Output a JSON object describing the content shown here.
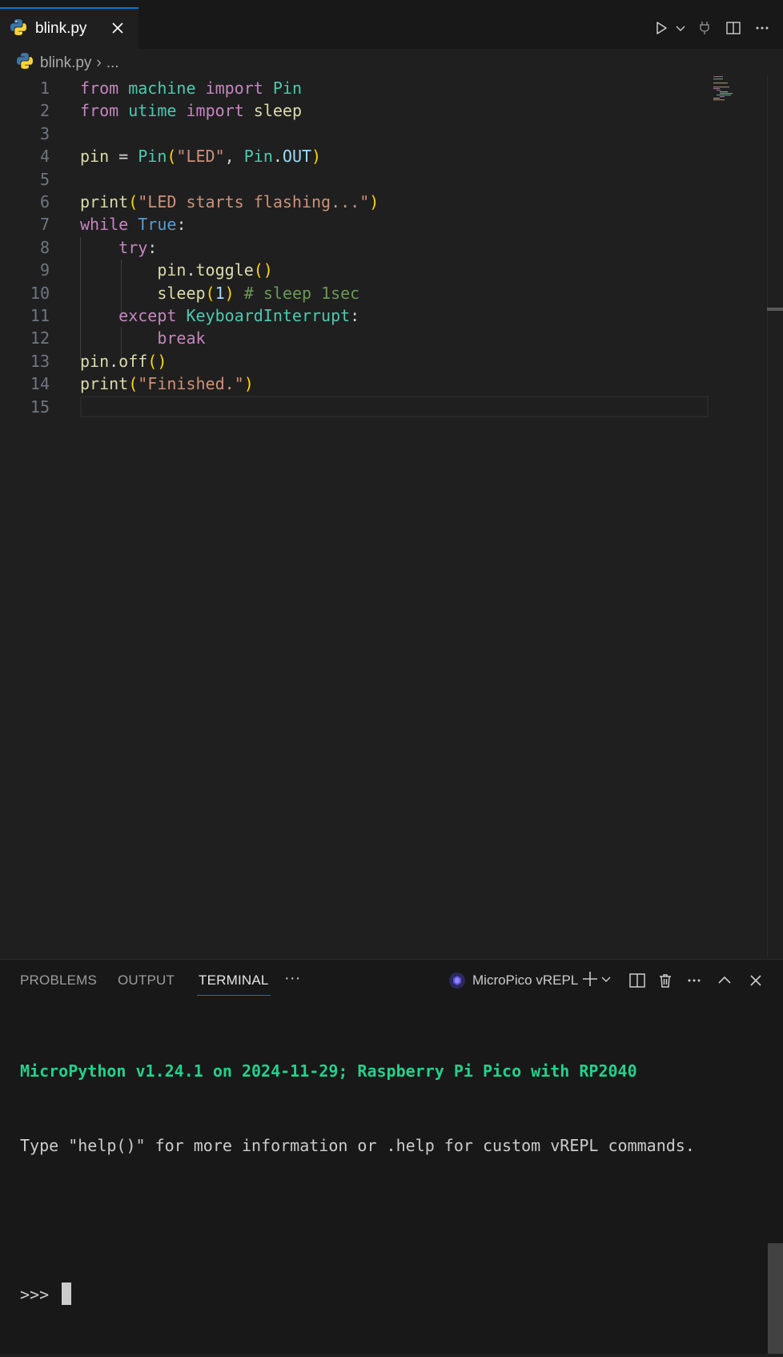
{
  "tab": {
    "filename": "blink.py",
    "close_glyph": "✕"
  },
  "editor_actions": [
    "run-icon",
    "chevron-down-icon",
    "plug-icon",
    "split-editor-icon",
    "more-icon"
  ],
  "breadcrumb": {
    "file": "blink.py",
    "separator": "›",
    "rest": "..."
  },
  "code_lines": [
    {
      "n": "1",
      "tokens": [
        {
          "t": "from",
          "c": "k"
        },
        {
          "t": " ",
          "c": "o"
        },
        {
          "t": "machine",
          "c": "t"
        },
        {
          "t": " ",
          "c": "o"
        },
        {
          "t": "import",
          "c": "k"
        },
        {
          "t": " ",
          "c": "o"
        },
        {
          "t": "Pin",
          "c": "t"
        }
      ]
    },
    {
      "n": "2",
      "tokens": [
        {
          "t": "from",
          "c": "k"
        },
        {
          "t": " ",
          "c": "o"
        },
        {
          "t": "utime",
          "c": "t"
        },
        {
          "t": " ",
          "c": "o"
        },
        {
          "t": "import",
          "c": "k"
        },
        {
          "t": " ",
          "c": "o"
        },
        {
          "t": "sleep",
          "c": "v"
        }
      ]
    },
    {
      "n": "3",
      "tokens": []
    },
    {
      "n": "4",
      "tokens": [
        {
          "t": "pin",
          "c": "v"
        },
        {
          "t": " = ",
          "c": "o"
        },
        {
          "t": "Pin",
          "c": "t"
        },
        {
          "t": "(",
          "c": "p"
        },
        {
          "t": "\"LED\"",
          "c": "s"
        },
        {
          "t": ", ",
          "c": "o"
        },
        {
          "t": "Pin",
          "c": "t"
        },
        {
          "t": ".",
          "c": "o"
        },
        {
          "t": "OUT",
          "c": "a"
        },
        {
          "t": ")",
          "c": "p"
        }
      ]
    },
    {
      "n": "5",
      "tokens": []
    },
    {
      "n": "6",
      "tokens": [
        {
          "t": "print",
          "c": "v"
        },
        {
          "t": "(",
          "c": "p"
        },
        {
          "t": "\"LED starts flashing...\"",
          "c": "s"
        },
        {
          "t": ")",
          "c": "p"
        }
      ]
    },
    {
      "n": "7",
      "tokens": [
        {
          "t": "while",
          "c": "k"
        },
        {
          "t": " ",
          "c": "o"
        },
        {
          "t": "True",
          "c": "b"
        },
        {
          "t": ":",
          "c": "o"
        }
      ]
    },
    {
      "n": "8",
      "tokens": [
        {
          "t": "    ",
          "c": "o"
        },
        {
          "t": "try",
          "c": "k"
        },
        {
          "t": ":",
          "c": "o"
        }
      ]
    },
    {
      "n": "9",
      "tokens": [
        {
          "t": "        ",
          "c": "o"
        },
        {
          "t": "pin",
          "c": "v"
        },
        {
          "t": ".",
          "c": "o"
        },
        {
          "t": "toggle",
          "c": "v"
        },
        {
          "t": "()",
          "c": "p"
        }
      ]
    },
    {
      "n": "10",
      "tokens": [
        {
          "t": "        ",
          "c": "o"
        },
        {
          "t": "sleep",
          "c": "v"
        },
        {
          "t": "(",
          "c": "p"
        },
        {
          "t": "1",
          "c": "a"
        },
        {
          "t": ")",
          "c": "p"
        },
        {
          "t": " ",
          "c": "o"
        },
        {
          "t": "# sleep 1sec",
          "c": "c"
        }
      ]
    },
    {
      "n": "11",
      "tokens": [
        {
          "t": "    ",
          "c": "o"
        },
        {
          "t": "except",
          "c": "k"
        },
        {
          "t": " ",
          "c": "o"
        },
        {
          "t": "KeyboardInterrupt",
          "c": "t"
        },
        {
          "t": ":",
          "c": "o"
        }
      ]
    },
    {
      "n": "12",
      "tokens": [
        {
          "t": "        ",
          "c": "o"
        },
        {
          "t": "break",
          "c": "k"
        }
      ]
    },
    {
      "n": "13",
      "tokens": [
        {
          "t": "pin",
          "c": "v"
        },
        {
          "t": ".",
          "c": "o"
        },
        {
          "t": "off",
          "c": "v"
        },
        {
          "t": "()",
          "c": "p"
        }
      ]
    },
    {
      "n": "14",
      "tokens": [
        {
          "t": "print",
          "c": "v"
        },
        {
          "t": "(",
          "c": "p"
        },
        {
          "t": "\"Finished.\"",
          "c": "s"
        },
        {
          "t": ")",
          "c": "p"
        }
      ]
    },
    {
      "n": "15",
      "tokens": []
    }
  ],
  "panel": {
    "tabs": [
      "PROBLEMS",
      "OUTPUT",
      "TERMINAL"
    ],
    "active_tab": "TERMINAL",
    "more": "···",
    "terminal_name": "MicroPico vREPL"
  },
  "terminal": {
    "banner": "MicroPython v1.24.1 on 2024-11-29; Raspberry Pi Pico with RP2040",
    "help_line": "Type \"help()\" for more information or .help for custom vREPL commands.",
    "prompt": ">>> "
  },
  "colors": {
    "accent": "#0078d4",
    "editor_bg": "#1f1f1f",
    "chrome_bg": "#181818",
    "keyword": "#c586c0",
    "type": "#4ec9b0",
    "function": "#dcdcaa",
    "string": "#ce9178",
    "bracket": "#ffd700",
    "comment": "#6a9955",
    "terminal_banner": "#23d18b"
  }
}
